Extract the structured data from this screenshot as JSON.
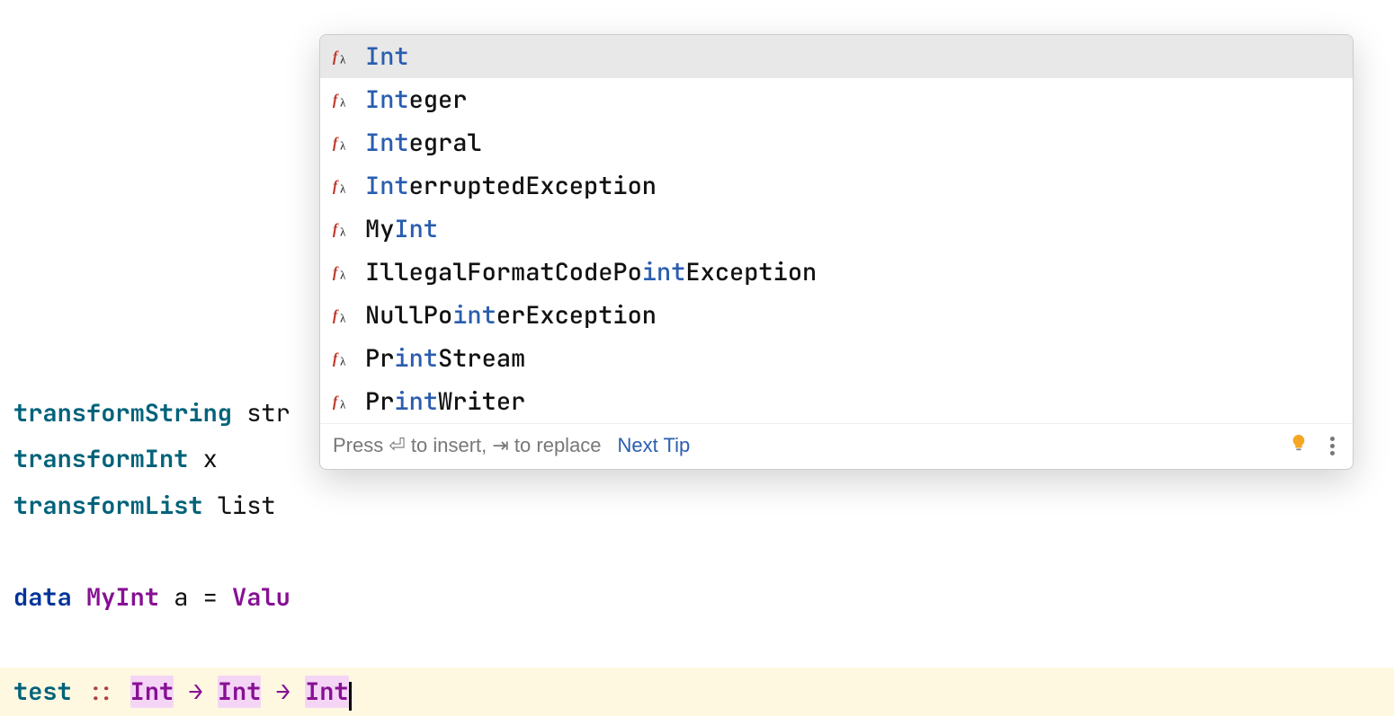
{
  "editor": {
    "lines": [
      {
        "segments": [
          {
            "text": "transformString",
            "cls": "kw-def"
          },
          {
            "text": " str",
            "cls": "plain"
          }
        ]
      },
      {
        "segments": [
          {
            "text": "transformInt",
            "cls": "kw-def"
          },
          {
            "text": " x",
            "cls": "plain"
          }
        ]
      },
      {
        "segments": [
          {
            "text": "transformList",
            "cls": "kw-def"
          },
          {
            "text": " list",
            "cls": "plain"
          }
        ]
      },
      {
        "segments": []
      },
      {
        "segments": [
          {
            "text": "data",
            "cls": "kw-data"
          },
          {
            "text": " ",
            "cls": "plain"
          },
          {
            "text": "MyInt",
            "cls": "type"
          },
          {
            "text": " a ",
            "cls": "plain"
          },
          {
            "text": "=",
            "cls": "plain"
          },
          {
            "text": " ",
            "cls": "plain"
          },
          {
            "text": "Valu",
            "cls": "type"
          }
        ]
      },
      {
        "segments": []
      },
      {
        "highlighted": true,
        "segments": [
          {
            "text": "test",
            "cls": "kw-def"
          },
          {
            "text": " ",
            "cls": "plain"
          },
          {
            "text": "::",
            "cls": "op2"
          },
          {
            "text": " ",
            "cls": "plain"
          },
          {
            "text": "Int",
            "cls": "type",
            "hl": true
          },
          {
            "text": " ",
            "cls": "plain"
          },
          {
            "text": "→",
            "cls": "op"
          },
          {
            "text": " ",
            "cls": "plain"
          },
          {
            "text": "Int",
            "cls": "type",
            "hl": true
          },
          {
            "text": " ",
            "cls": "plain"
          },
          {
            "text": "→",
            "cls": "op"
          },
          {
            "text": " ",
            "cls": "plain"
          },
          {
            "text": "Int",
            "cls": "type",
            "hl": true,
            "caret": true
          }
        ]
      }
    ]
  },
  "completion": {
    "match": "Int",
    "items": [
      {
        "pre": "",
        "m": "Int",
        "post": "",
        "selected": true
      },
      {
        "pre": "",
        "m": "Int",
        "post": "eger",
        "selected": false
      },
      {
        "pre": "",
        "m": "Int",
        "post": "egral",
        "selected": false
      },
      {
        "pre": "",
        "m": "Int",
        "post": "erruptedException",
        "selected": false
      },
      {
        "pre": "My",
        "m": "Int",
        "post": "",
        "selected": false
      },
      {
        "pre": "IllegalFormatCodePo",
        "m": "int",
        "post": "Exception",
        "selected": false
      },
      {
        "pre": "NullPo",
        "m": "int",
        "post": "erException",
        "selected": false
      },
      {
        "pre": "Pr",
        "m": "int",
        "post": "Stream",
        "selected": false
      },
      {
        "pre": "Pr",
        "m": "int",
        "post": "Writer",
        "selected": false
      }
    ],
    "footer": {
      "hint": "Press ⏎ to insert, ⇥ to replace",
      "link": "Next Tip"
    }
  },
  "icons": {
    "completion_item": "lambda-function-icon",
    "hint_bulb": "light-bulb-icon",
    "more": "more-vertical-icon"
  }
}
